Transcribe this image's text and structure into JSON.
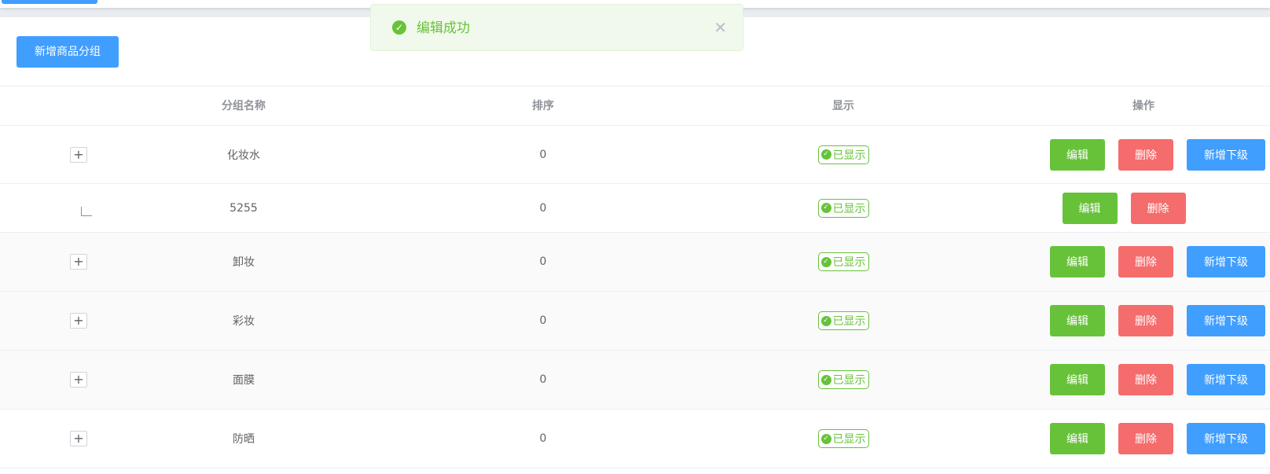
{
  "toast": {
    "message": "编辑成功",
    "icon": "check-circle-icon",
    "close_icon": "close-icon",
    "color": "#67c23a"
  },
  "toolbar": {
    "add_group_label": "新增商品分组"
  },
  "table": {
    "headers": {
      "name": "分组名称",
      "sort": "排序",
      "show": "显示",
      "ops": "操作"
    },
    "rows": [
      {
        "name": "化妆水",
        "sort": "0",
        "status": "已显示",
        "edit": "编辑",
        "delete": "删除",
        "add_child": "新增下级",
        "expandable": true
      },
      {
        "name": "5255",
        "sort": "0",
        "status": "已显示",
        "edit": "编辑",
        "delete": "删除",
        "child": true
      },
      {
        "name": "卸妆",
        "sort": "0",
        "status": "已显示",
        "edit": "编辑",
        "delete": "删除",
        "add_child": "新增下级",
        "expandable": true
      },
      {
        "name": "彩妆",
        "sort": "0",
        "status": "已显示",
        "edit": "编辑",
        "delete": "删除",
        "add_child": "新增下级",
        "expandable": true
      },
      {
        "name": "面膜",
        "sort": "0",
        "status": "已显示",
        "edit": "编辑",
        "delete": "删除",
        "add_child": "新增下级",
        "expandable": true
      },
      {
        "name": "防晒",
        "sort": "0",
        "status": "已显示",
        "edit": "编辑",
        "delete": "删除",
        "add_child": "新增下级",
        "expandable": true
      }
    ]
  },
  "colors": {
    "primary": "#409eff",
    "success": "#67c23a",
    "danger": "#f56c6c"
  }
}
